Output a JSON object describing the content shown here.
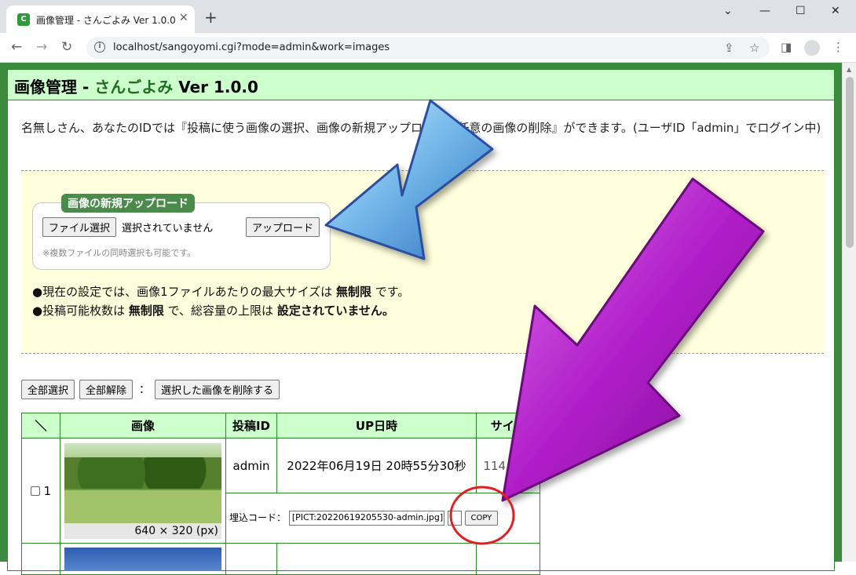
{
  "browser": {
    "tab_title": "画像管理 - さんごよみ Ver 1.0.0",
    "url": "localhost/sangoyomi.cgi?mode=admin&work=images"
  },
  "page": {
    "header": {
      "title_main": "画像管理 - ",
      "title_app": "さんごよみ",
      "title_ver": " Ver 1.0.0"
    },
    "intro": "名無しさん、あなたのIDでは『投稿に使う画像の選択、画像の新規アップロード、任意の画像の削除』ができます。(ユーザID「admin」でログイン中)",
    "upload": {
      "legend": "画像の新規アップロード",
      "choose_file": "ファイル選択",
      "file_status": "選択されていません",
      "upload_button": "アップロード",
      "note": "※複数ファイルの同時選択も可能です。"
    },
    "info": {
      "line1_pre": "●現在の設定では、画像1ファイルあたりの最大サイズは ",
      "line1_bold": "無制限",
      "line1_post": " です。",
      "line2_pre": "●投稿可能枚数は ",
      "line2_bold1": "無制限",
      "line2_mid": " で、総容量の上限は ",
      "line2_bold2": "設定されていません。"
    },
    "actions": {
      "select_all": "全部選択",
      "deselect_all": "全部解除",
      "separator": "：",
      "delete_selected": "選択した画像を削除する"
    },
    "table": {
      "headers": [
        "＼",
        "画像",
        "投稿ID",
        "UP日時",
        "サイズ"
      ],
      "rows": [
        {
          "number": "1",
          "dimensions": "640 × 320 (px)",
          "poster_id": "admin",
          "uploaded_at": "2022年06月19日 20時55分30秒",
          "size": "114.4KB",
          "embed_label": "埋込コード：",
          "embed_code": "[PICT:20220619205530-admin.jpg]",
          "copy_label": "COPY"
        }
      ]
    }
  },
  "colors": {
    "header_bg": "#ccffcc",
    "border_green": "#2a8a2a",
    "upload_bg": "#ffffdd",
    "legend_bg": "#4a8a4a",
    "arrow_blue": "#6fb4e8",
    "arrow_purple": "#b01ec8",
    "circle_red": "#e02020"
  }
}
